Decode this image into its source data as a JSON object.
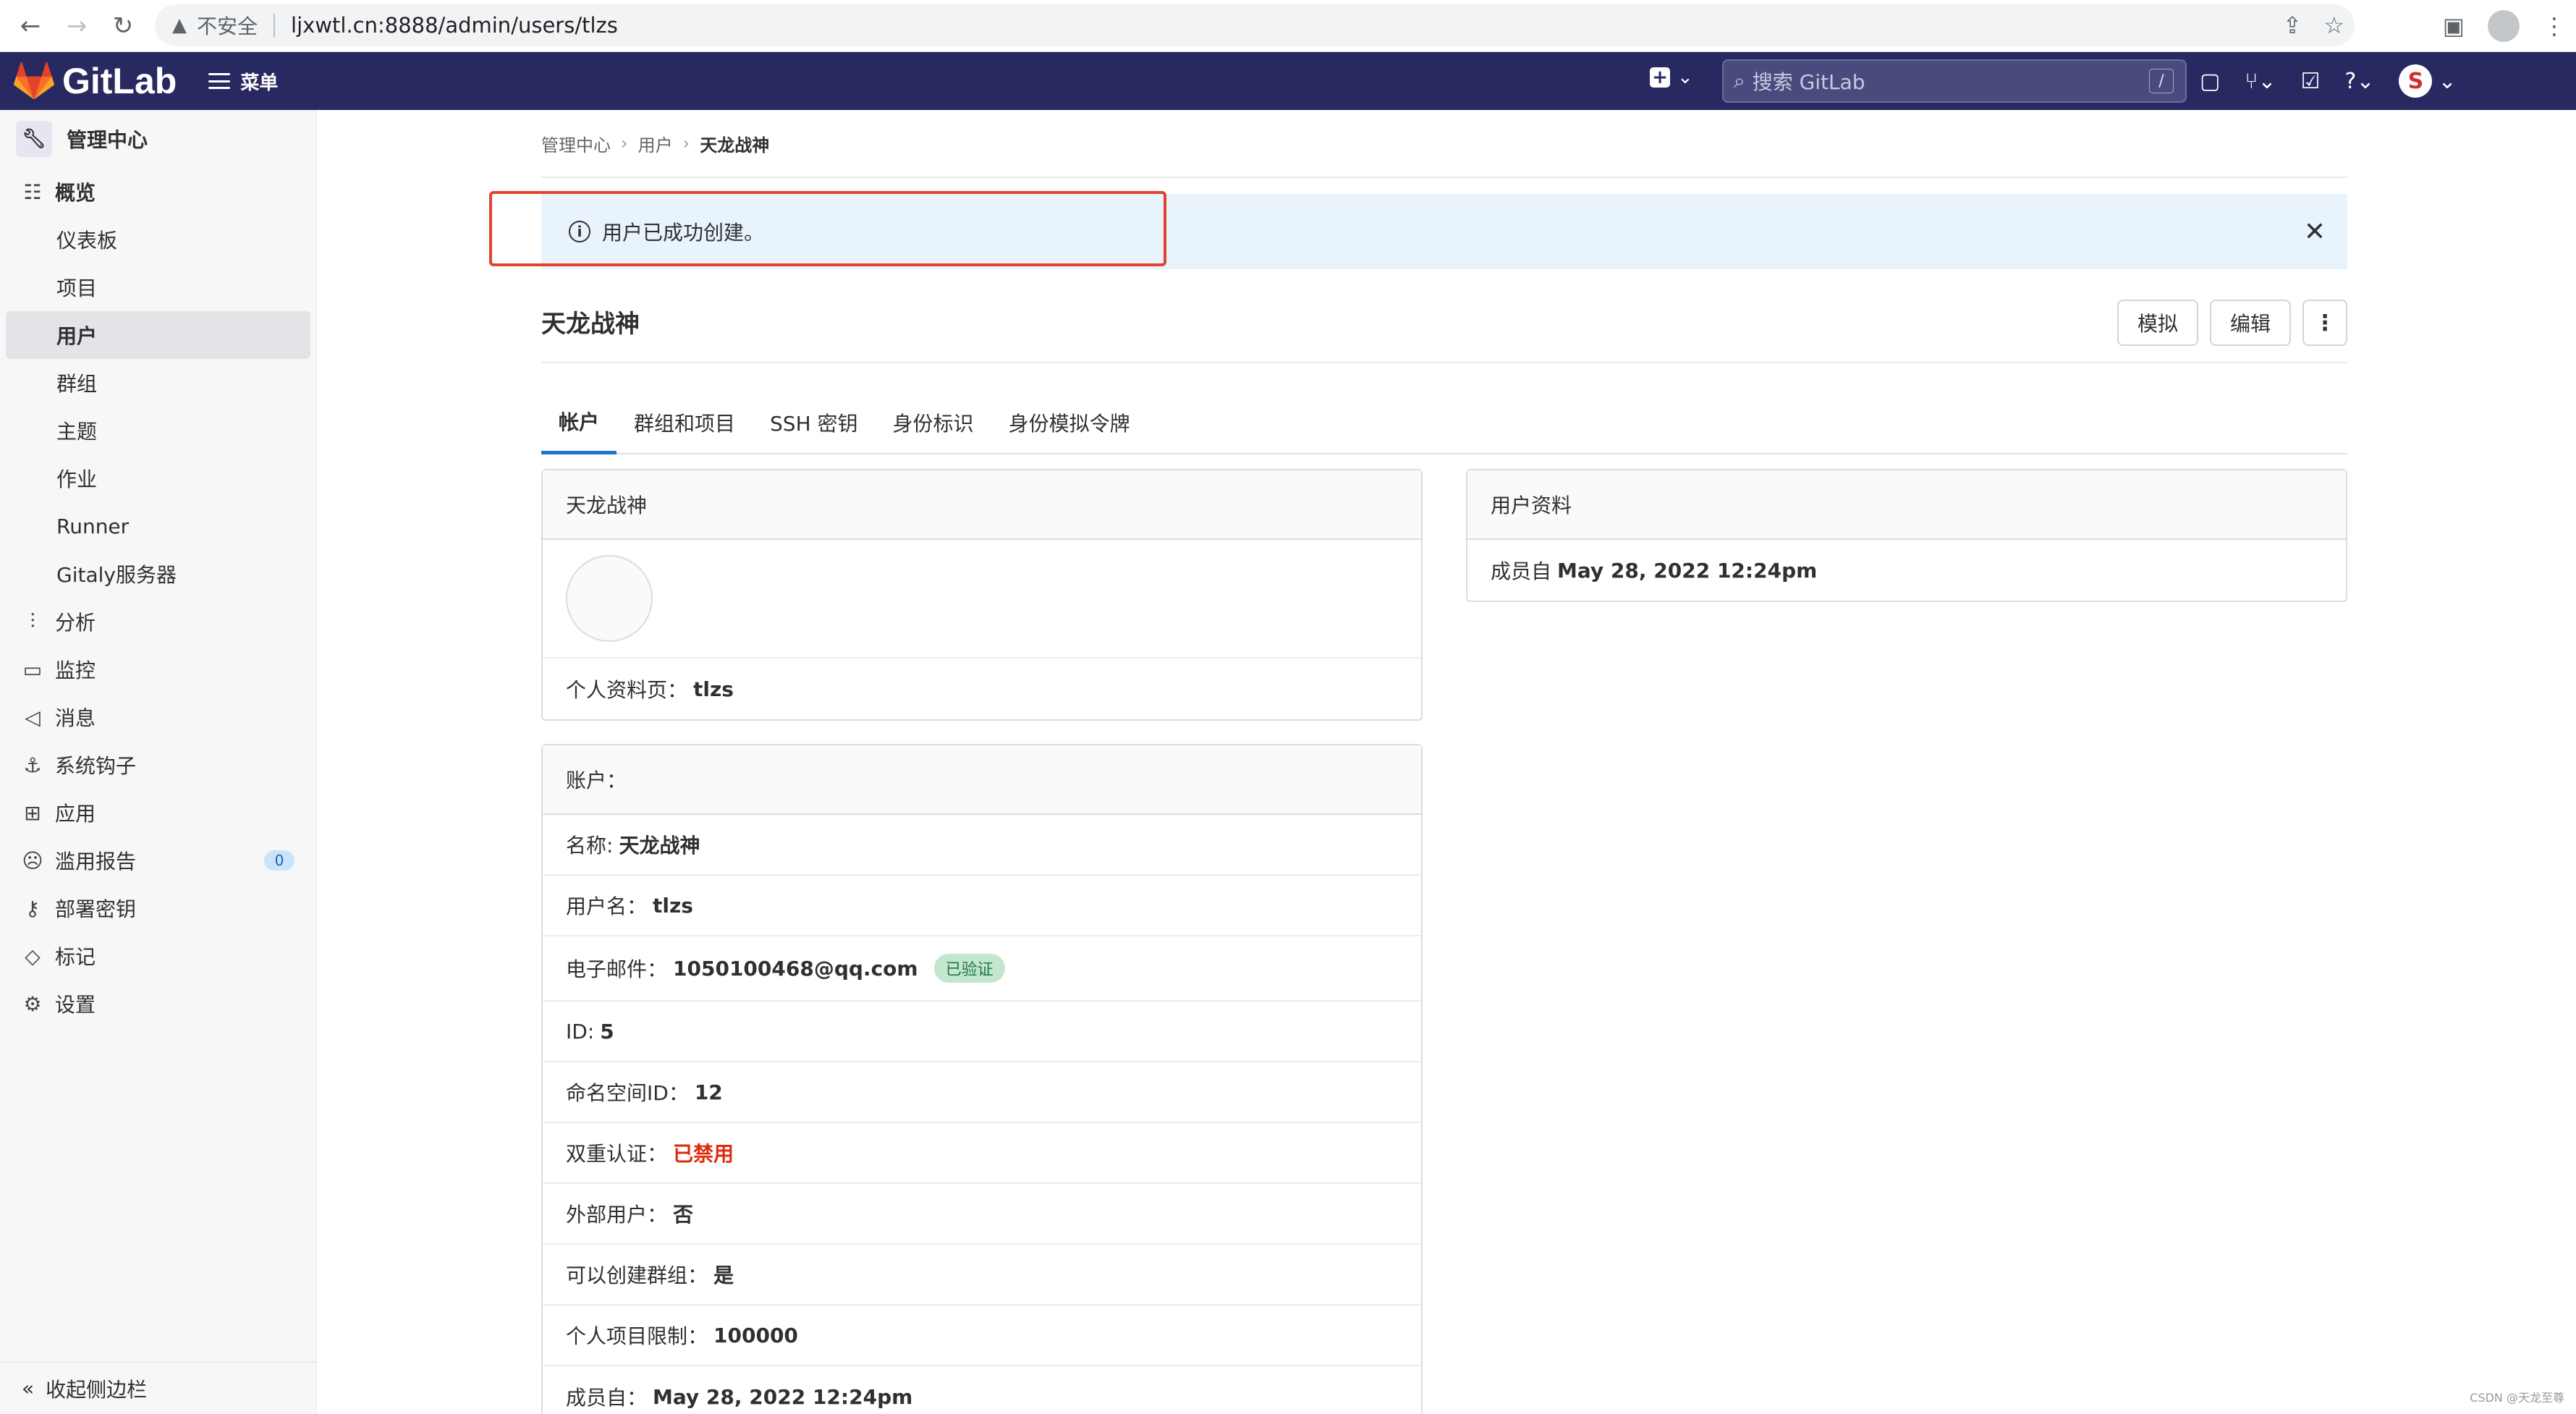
{
  "browser": {
    "insecure_label": "不安全",
    "url": "ljxwtl.cn:8888/admin/users/tlzs"
  },
  "topbar": {
    "logo_text": "GitLab",
    "menu_label": "菜单",
    "search_placeholder": "搜索 GitLab",
    "search_shortcut": "/",
    "avatar_letter": "S"
  },
  "sidebar": {
    "header": "管理中心",
    "items": [
      {
        "label": "概览"
      },
      {
        "label": "仪表板"
      },
      {
        "label": "项目"
      },
      {
        "label": "用户"
      },
      {
        "label": "群组"
      },
      {
        "label": "主题"
      },
      {
        "label": "作业"
      },
      {
        "label": "Runner"
      },
      {
        "label": "Gitaly服务器"
      },
      {
        "label": "分析"
      },
      {
        "label": "监控"
      },
      {
        "label": "消息"
      },
      {
        "label": "系统钩子"
      },
      {
        "label": "应用"
      },
      {
        "label": "滥用报告",
        "count": "0"
      },
      {
        "label": "部署密钥"
      },
      {
        "label": "标记"
      },
      {
        "label": "设置"
      }
    ],
    "collapse_label": "收起侧边栏"
  },
  "breadcrumb": {
    "items": [
      "管理中心",
      "用户",
      "天龙战神"
    ]
  },
  "alert": {
    "message": "用户已成功创建。"
  },
  "page": {
    "title": "天龙战神",
    "actions": {
      "impersonate": "模拟",
      "edit": "编辑"
    }
  },
  "tabs": [
    "帐户",
    "群组和项目",
    "SSH 密钥",
    "身份标识",
    "身份模拟令牌"
  ],
  "profile_card": {
    "header": "天龙战神",
    "profile_page_label": "个人资料页：",
    "profile_page_value": "tlzs"
  },
  "account_card": {
    "header": "账户：",
    "name_label": "名称:",
    "name_value": "天龙战神",
    "username_label": "用户名：",
    "username_value": "tlzs",
    "email_label": "电子邮件：",
    "email_value": "1050100468@qq.com",
    "email_badge": "已验证",
    "id_label": "ID:",
    "id_value": "5",
    "namespace_label": "命名空间ID：",
    "namespace_value": "12",
    "twofa_label": "双重认证：",
    "twofa_value": "已禁用",
    "external_label": "外部用户：",
    "external_value": "否",
    "can_create_group_label": "可以创建群组：",
    "can_create_group_value": "是",
    "project_limit_label": "个人项目限制：",
    "project_limit_value": "100000",
    "member_since_label": "成员自：",
    "member_since_value": "May 28, 2022 12:24pm"
  },
  "user_profile_card": {
    "header": "用户资料",
    "member_since_label": "成员自",
    "member_since_value": "May 28, 2022 12:24pm"
  },
  "watermark": "CSDN @天龙至尊",
  "colors": {
    "topbar": "#292961",
    "alert_bg": "#e9f3fc",
    "annotation_border": "#e0432f",
    "active_tab": "#1f75cb",
    "danger": "#dd2b0e"
  }
}
